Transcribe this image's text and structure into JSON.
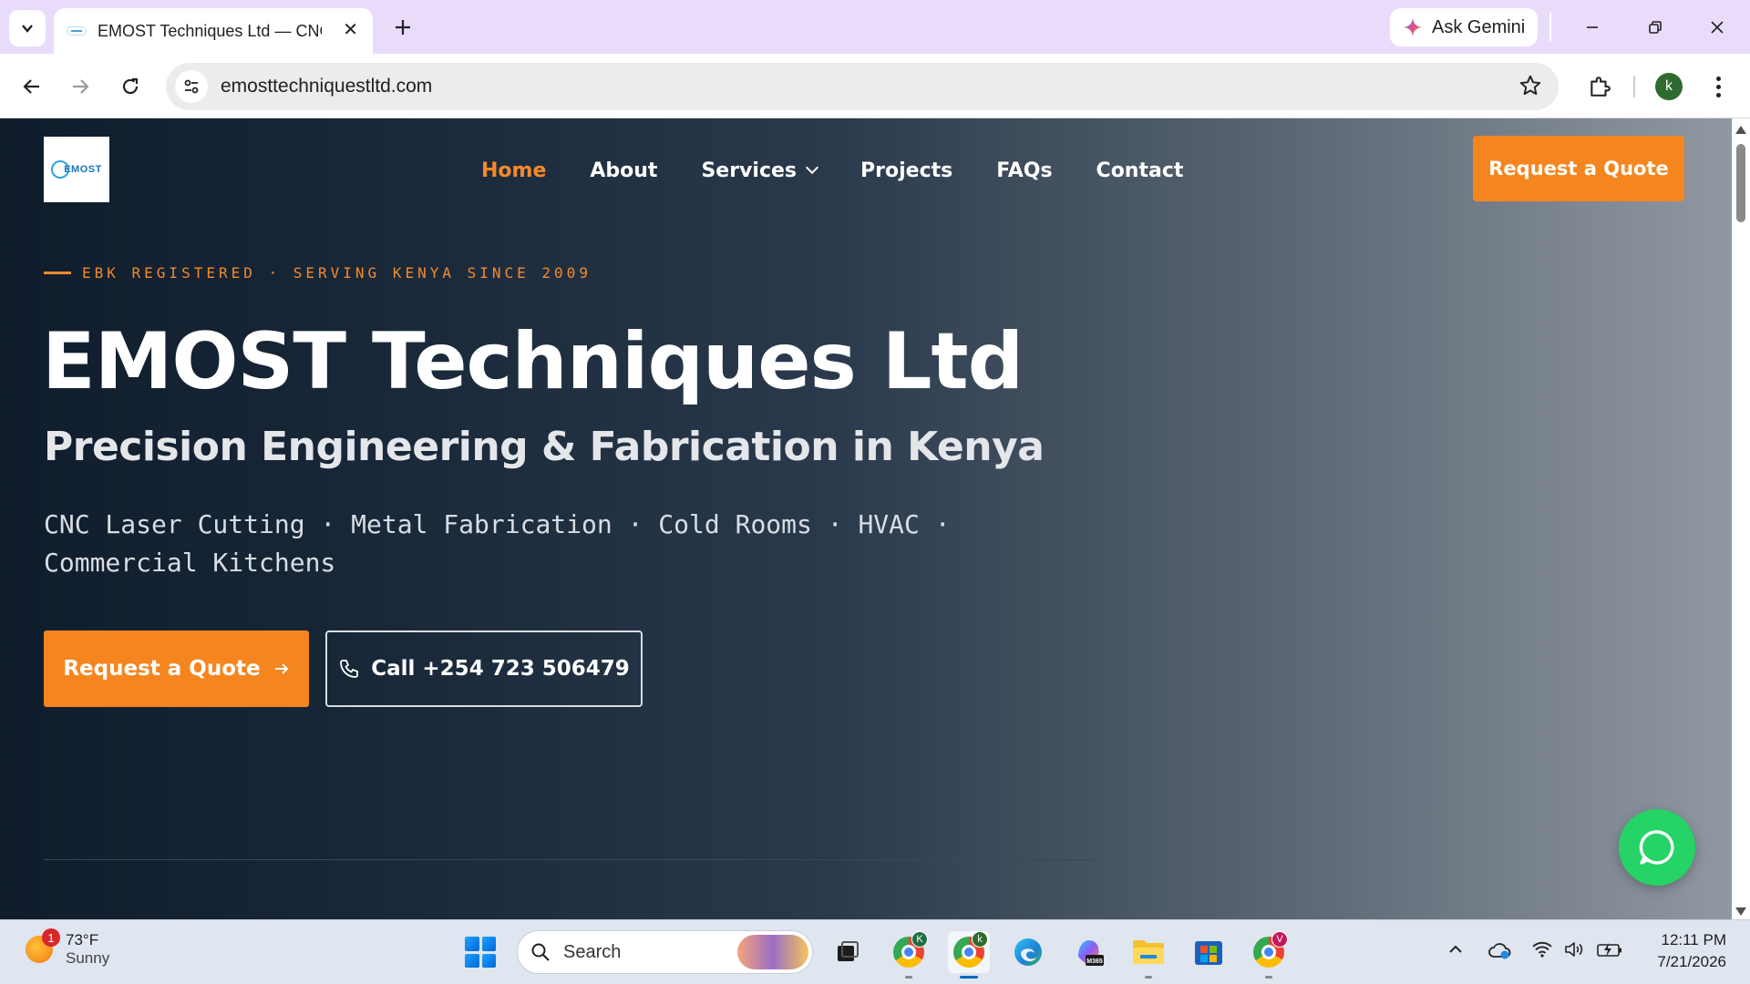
{
  "browser": {
    "tab_title": "EMOST Techniques Ltd — CNC",
    "url": "emosttechniquestltd.com",
    "gemini_label": "Ask Gemini",
    "profile_initial": "k"
  },
  "site": {
    "logo_text": "EMOST",
    "nav": [
      {
        "label": "Home",
        "active": true
      },
      {
        "label": "About"
      },
      {
        "label": "Services",
        "has_dropdown": true
      },
      {
        "label": "Projects"
      },
      {
        "label": "FAQs"
      },
      {
        "label": "Contact"
      }
    ],
    "header_cta": "Request a Quote",
    "eyebrow": "EBK REGISTERED · SERVING KENYA SINCE 2009",
    "title": "EMOST Techniques Ltd",
    "subtitle": "Precision Engineering & Fabrication in Kenya",
    "services_line": "CNC Laser Cutting · Metal Fabrication · Cold Rooms · HVAC · Commercial Kitchens",
    "primary_button": "Request a Quote",
    "primary_button_icon": "arrow-right-icon",
    "call_button": "Call +254 723 506479",
    "call_button_icon": "phone-icon",
    "colors": {
      "accent": "#f5861f",
      "whatsapp": "#25d366"
    }
  },
  "taskbar": {
    "weather_temp": "73°F",
    "weather_condition": "Sunny",
    "weather_badge": "1",
    "search_label": "Search",
    "time": "12:11 PM",
    "date": "7/21/2026",
    "apps": [
      {
        "name": "chrome-profile-K",
        "badge": "K",
        "badge_color": "#1f6f43"
      },
      {
        "name": "chrome-profile-k",
        "badge": "k",
        "badge_color": "#2f6b2f",
        "active": true
      },
      {
        "name": "edge"
      },
      {
        "name": "m365-copilot",
        "label": "M365"
      },
      {
        "name": "file-explorer"
      },
      {
        "name": "microsoft-store"
      },
      {
        "name": "chrome-profile-V",
        "badge": "V",
        "badge_color": "#c2185b"
      }
    ]
  }
}
